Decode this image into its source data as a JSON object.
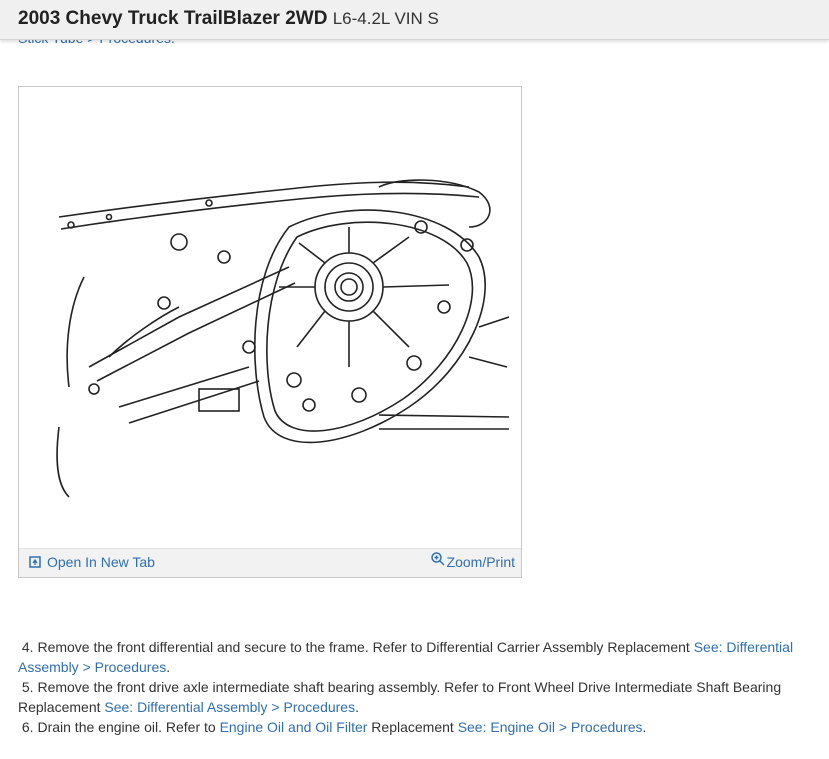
{
  "header": {
    "title_bold": "2003 Chevy Truck TrailBlazer 2WD",
    "title_sub": "L6-4.2L VIN S"
  },
  "cutoff_text": "Stick Tube > Procedures.",
  "figure": {
    "open_new_tab_label": "Open In New Tab",
    "zoom_print_label": "Zoom/Print",
    "open_icon": "open-new-tab-icon",
    "zoom_icon": "magnifier-plus-icon"
  },
  "steps": [
    {
      "text": "4. Remove the front differential and secure to the frame. Refer to Differential Carrier Assembly Replacement ",
      "link1": "See: Differential Assembly > Procedures",
      "end": "."
    },
    {
      "text": "5. Remove the front drive axle intermediate shaft bearing assembly. Refer to Front Wheel Drive Intermediate Shaft Bearing Replacement ",
      "link1": "See: Differential Assembly > Procedures",
      "end": "."
    },
    {
      "text": "6. Drain the engine oil. Refer to ",
      "link0": "Engine Oil and Oil Filter",
      "mid": " Replacement ",
      "link1": "See: Engine Oil > Procedures",
      "end": "."
    }
  ],
  "colors": {
    "link": "#2f6fb3",
    "header_bg": "#f0f0f1",
    "text": "#333333"
  }
}
